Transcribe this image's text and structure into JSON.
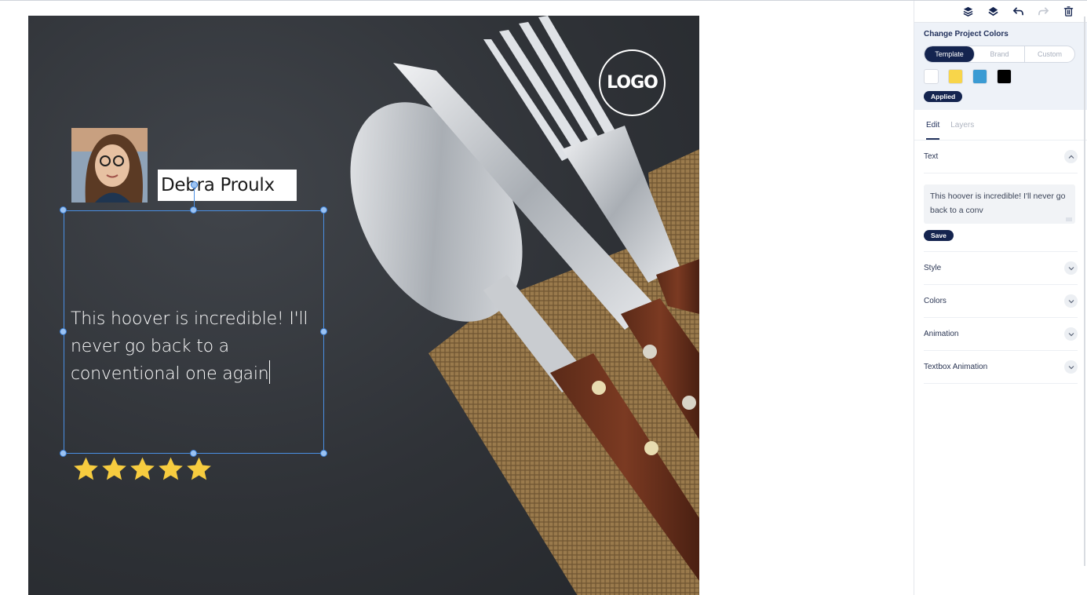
{
  "canvas": {
    "logo_text": "LOGO",
    "reviewer_name": "Debra Proulx",
    "review_lines": [
      "This hoover is incredible! I'll",
      "never go back to a",
      "conventional one again"
    ],
    "rating": 5,
    "rating_max": 5
  },
  "toolbar": {
    "icons": [
      "layer-up-icon",
      "layers-icon",
      "undo-icon",
      "redo-icon",
      "trash-icon"
    ]
  },
  "colors_section": {
    "title": "Change Project Colors",
    "tabs": [
      "Template",
      "Brand",
      "Custom"
    ],
    "active_tab": "Template",
    "swatches": [
      "#ffffff",
      "#f8d54a",
      "#3b9bd3",
      "#000000"
    ],
    "applied_label": "Applied"
  },
  "edit_tabs": {
    "edit": "Edit",
    "layers": "Layers"
  },
  "text_section": {
    "label": "Text",
    "value": "This hoover is incredible! I'll never go back to a conv",
    "save_label": "Save"
  },
  "accordions": {
    "style": "Style",
    "colors": "Colors",
    "animation": "Animation",
    "textbox_animation": "Textbox Animation"
  }
}
